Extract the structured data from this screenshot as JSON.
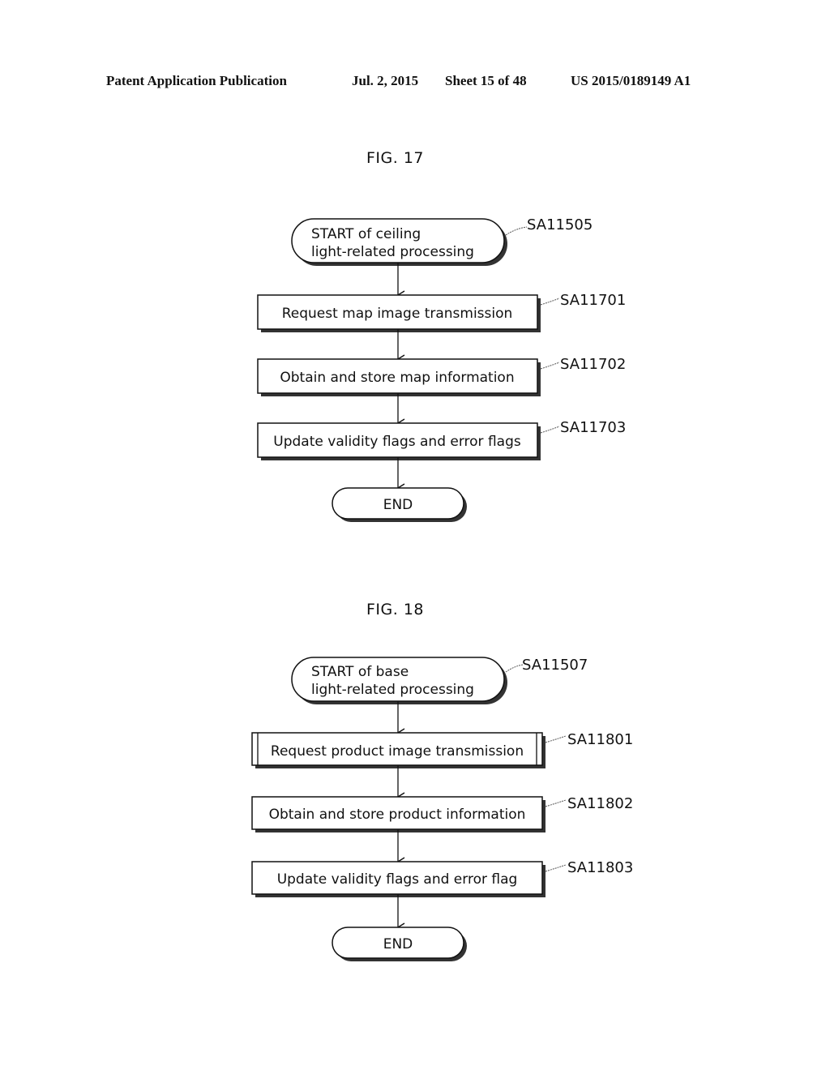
{
  "header": {
    "publication": "Patent Application Publication",
    "date": "Jul. 2, 2015",
    "sheet": "Sheet 15 of 48",
    "number": "US 2015/0189149 A1"
  },
  "figures": [
    {
      "title": "FIG. 17",
      "start": {
        "lines": [
          "START of ceiling",
          "light-related processing"
        ],
        "ref": "SA11505"
      },
      "steps": [
        {
          "label": "Request map image transmission",
          "ref": "SA11701",
          "subroutine": false
        },
        {
          "label": "Obtain and store map information",
          "ref": "SA11702",
          "subroutine": false
        },
        {
          "label": "Update validity flags and error flags",
          "ref": "SA11703",
          "subroutine": false
        }
      ],
      "end": {
        "label": "END"
      }
    },
    {
      "title": "FIG. 18",
      "start": {
        "lines": [
          "START of base",
          "light-related processing"
        ],
        "ref": "SA11507"
      },
      "steps": [
        {
          "label": "Request product image transmission",
          "ref": "SA11801",
          "subroutine": true
        },
        {
          "label": "Obtain and store product information",
          "ref": "SA11802",
          "subroutine": false
        },
        {
          "label": "Update validity flags and error flag",
          "ref": "SA11803",
          "subroutine": false
        }
      ],
      "end": {
        "label": "END"
      }
    }
  ]
}
